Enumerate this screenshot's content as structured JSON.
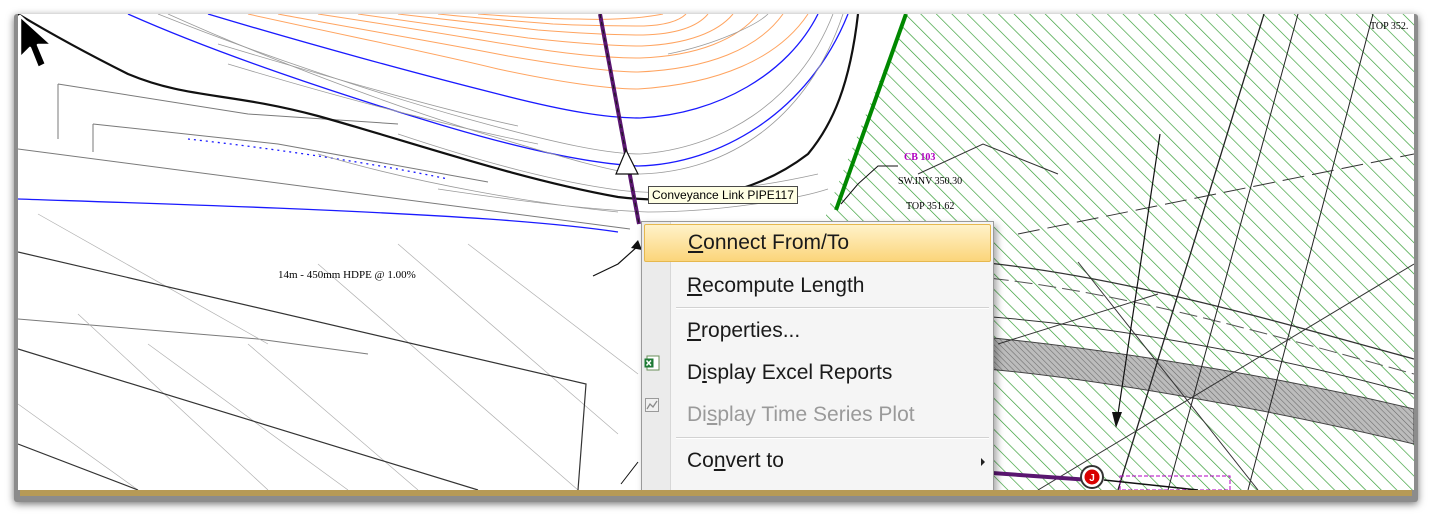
{
  "drawing": {
    "pipe_label": "14m - 450mm HDPE @ 1.00%",
    "structure_id": "CB 103",
    "structure_invert": "SW.INV 350.30",
    "structure_top": "TOP 351.62",
    "corner_text": "TOP 352.",
    "junction_marker": "J"
  },
  "tooltip": {
    "text": "Conveyance Link PIPE117"
  },
  "context_menu": {
    "items": [
      {
        "label": "Connect From/To",
        "mnemonic": "C",
        "rest": "onnect From/To",
        "state": "highlighted",
        "icon": "",
        "submenu": false
      },
      {
        "label": "Recompute Length",
        "mnemonic": "R",
        "rest": "ecompute Length",
        "state": "enabled",
        "icon": "",
        "submenu": false
      },
      {
        "label": "Properties...",
        "mnemonic": "P",
        "rest": "roperties...",
        "state": "enabled",
        "icon": "",
        "submenu": false
      },
      {
        "label": "Display Excel Reports",
        "pre": "D",
        "mnemonic": "i",
        "rest": "splay Excel Reports",
        "state": "enabled",
        "icon": "excel-icon",
        "submenu": false
      },
      {
        "label": "Display Time Series Plot",
        "pre": "Di",
        "mnemonic": "s",
        "rest": "play Time Series Plot",
        "state": "disabled",
        "icon": "time-series-plot-icon",
        "submenu": false
      },
      {
        "label": "Convert to",
        "pre": "Co",
        "mnemonic": "n",
        "rest": "vert to",
        "state": "enabled",
        "icon": "",
        "submenu": true
      }
    ]
  },
  "colors": {
    "contour_blue": "#1a1aff",
    "contour_orange": "#ffa460",
    "hatch_green": "#2e9a2e",
    "pipe_purple": "#5a1670",
    "boundary_green": "#008800",
    "label_magenta": "#b000c0",
    "menu_highlight": "#fbd57a",
    "frame_gold": "#b69a56"
  }
}
